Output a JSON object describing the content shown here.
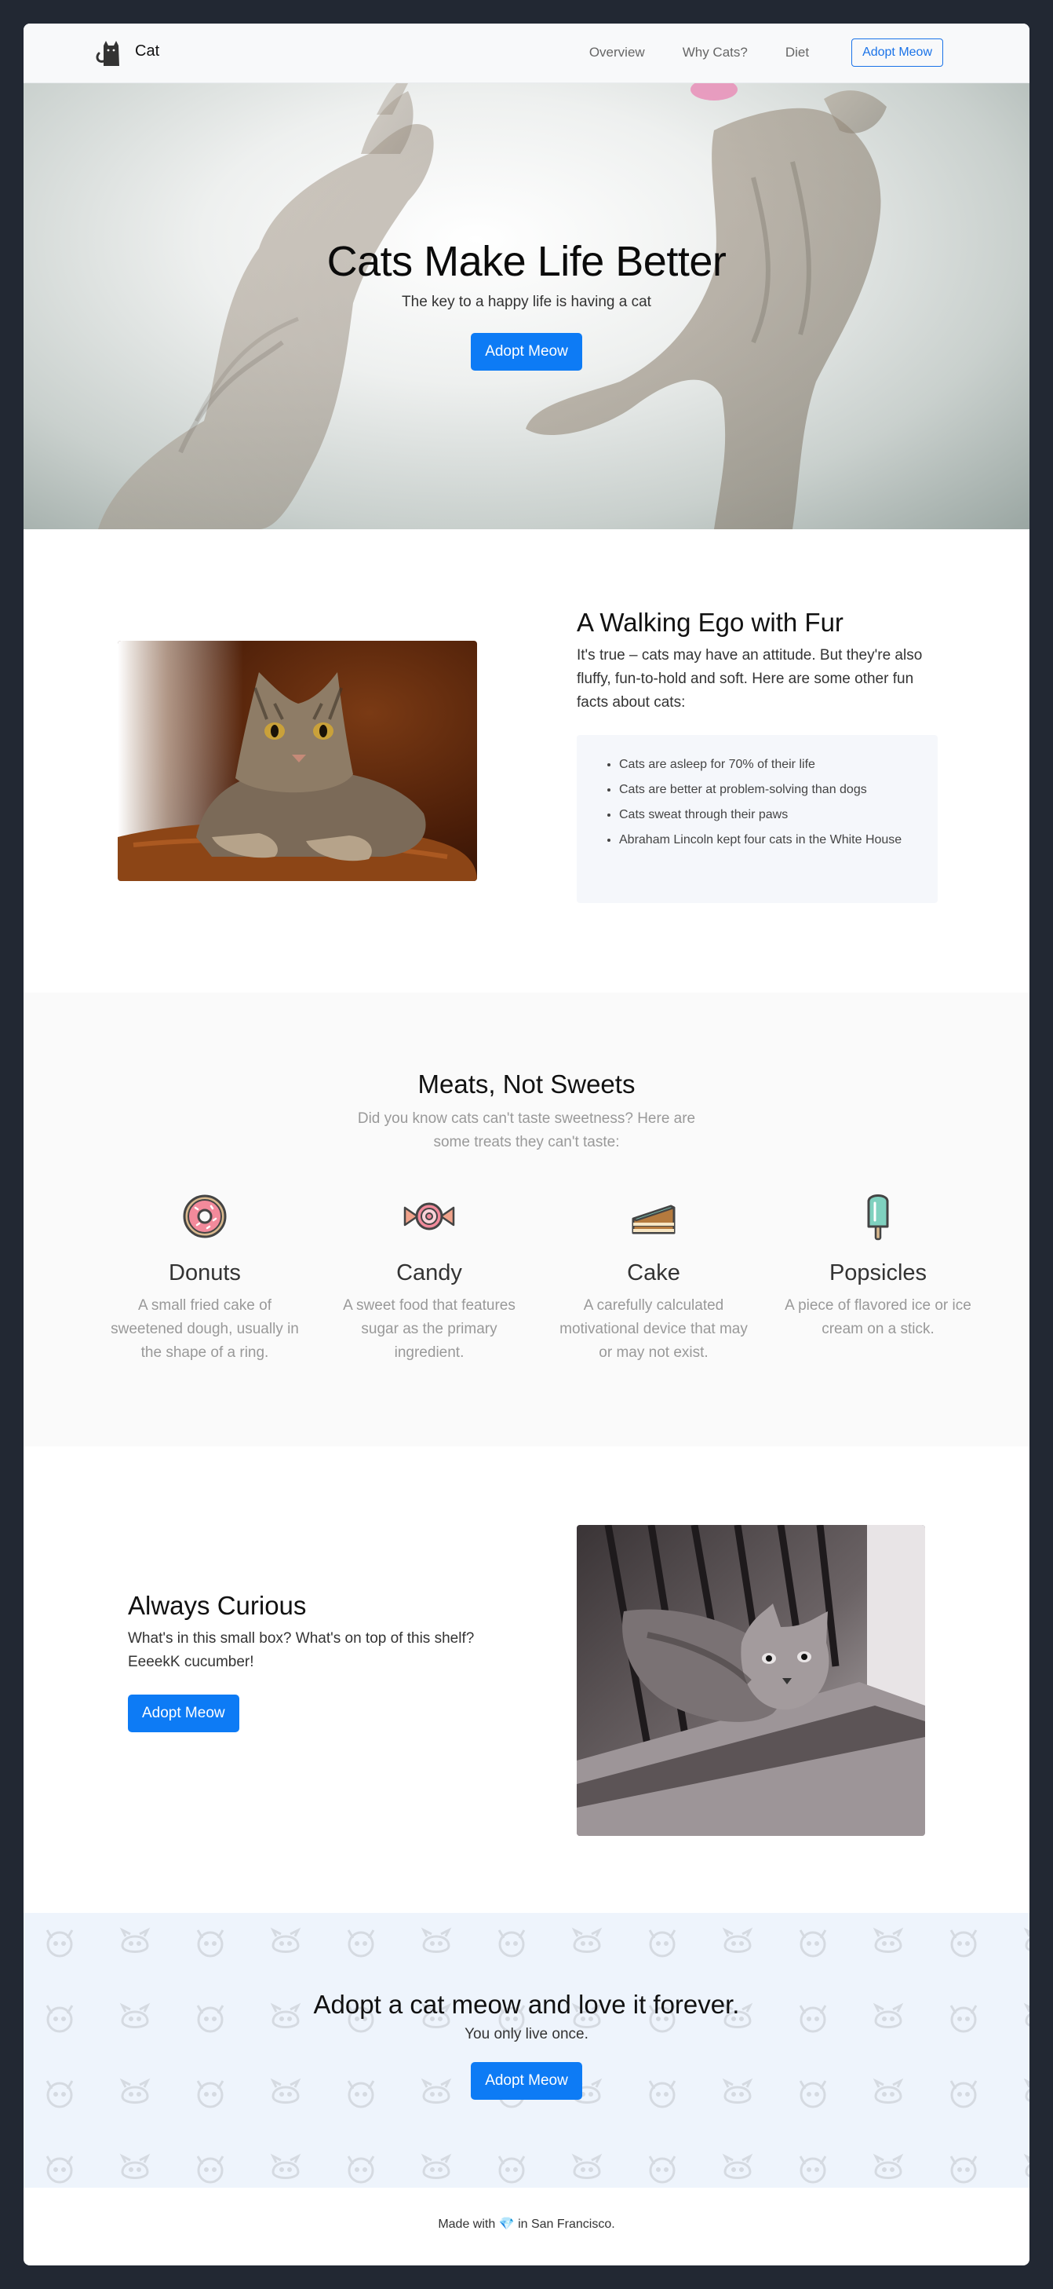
{
  "nav": {
    "brand": "Cat",
    "links": [
      "Overview",
      "Why Cats?",
      "Diet"
    ],
    "cta": "Adopt Meow"
  },
  "hero": {
    "title": "Cats Make Life Better",
    "subtitle": "The key to a happy life is having a cat",
    "button": "Adopt Meow"
  },
  "ego": {
    "title": "A Walking Ego with Fur",
    "body": "It's true – cats may have an attitude. But they're also fluffy, fun-to-hold and soft. Here are some other fun facts about cats:",
    "facts": [
      "Cats are asleep for 70% of their life",
      "Cats are better at problem-solving than dogs",
      "Cats sweat through their paws",
      "Abraham Lincoln kept four cats in the White House"
    ]
  },
  "diet": {
    "title": "Meats, Not Sweets",
    "subtitle": "Did you know cats can't taste sweetness? Here are some treats they can't taste:",
    "treats": [
      {
        "name": "Donuts",
        "icon": "donut-icon",
        "desc": "A small fried cake of sweetened dough, usually in the shape of a ring."
      },
      {
        "name": "Candy",
        "icon": "candy-icon",
        "desc": "A sweet food that features sugar as the primary ingredient."
      },
      {
        "name": "Cake",
        "icon": "cake-icon",
        "desc": "A carefully calculated motivational device that may or may not exist."
      },
      {
        "name": "Popsicles",
        "icon": "popsicle-icon",
        "desc": "A piece of flavored ice or ice cream on a stick."
      }
    ]
  },
  "curious": {
    "title": "Always Curious",
    "body": "What's in this small box? What's on top of this shelf? EeeekK cucumber!",
    "button": "Adopt Meow"
  },
  "cta": {
    "title": "Adopt a cat meow and love it forever.",
    "subtitle": "You only live once.",
    "button": "Adopt Meow"
  },
  "footer": {
    "prefix": "Made with",
    "heart": "💎",
    "suffix": "in San Francisco."
  },
  "colors": {
    "primary": "#0d7bf5",
    "frame_bg": "#222833",
    "cta_bg": "#eef4fc"
  }
}
